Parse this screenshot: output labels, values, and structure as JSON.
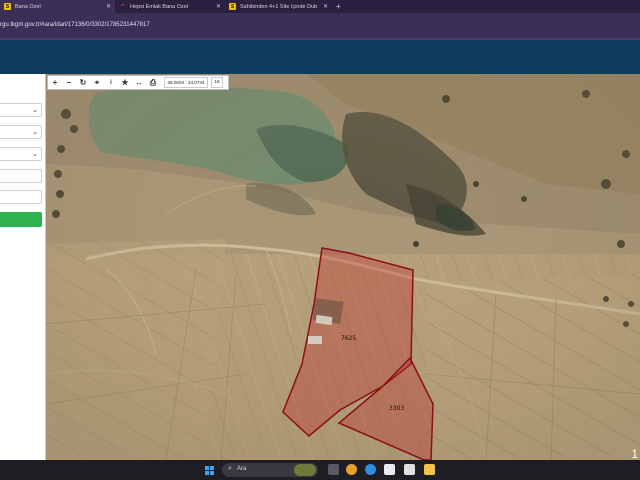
{
  "browser": {
    "tabs": [
      {
        "label": "Bana Özel",
        "favicon": "sahibinden-s-icon",
        "active": true
      },
      {
        "label": "Hepsi Emlak Bana Özel",
        "favicon": "hepsiemlak-icon",
        "active": false
      },
      {
        "label": "Sahibinden 4+1 Site İçinde Dub",
        "favicon": "sahibinden-s-icon",
        "active": false
      }
    ],
    "new_tab": "+",
    "url": "rgu.tkgm.gov.tr/#ara/idari/17136/0/3302/1785231447817"
  },
  "map": {
    "toolbar": {
      "zoom_in": "+",
      "zoom_out": "−",
      "refresh": "↻",
      "locate": "⌖",
      "info": "i",
      "favorite": "★",
      "measure": "↔",
      "print": "⎙",
      "coordinates": "39.0004 : 34.0734",
      "zoom_level": "16"
    },
    "parcel_labels": [
      "7625",
      "3303"
    ],
    "edge_digit": "1"
  },
  "taskbar": {
    "search_text": "Ara"
  },
  "colors": {
    "tab_strip": "#2a2140",
    "header": "#0d3c5c",
    "query_button": "#2db24f",
    "parcel_fill": "#c0282a",
    "parcel_stroke": "#8a0f18"
  }
}
